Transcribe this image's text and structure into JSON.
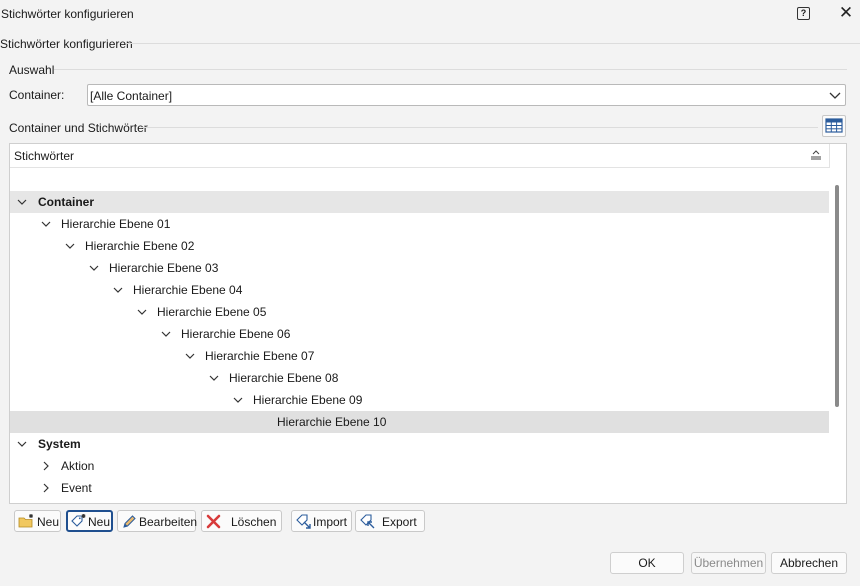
{
  "window": {
    "title": "Stichwörter konfigurieren"
  },
  "group_title": "Stichwörter konfigurieren",
  "auswahl": {
    "label": "Auswahl",
    "container_label": "Container:",
    "container_value": "[Alle Container]"
  },
  "tree_section_label": "Container und Stichwörter",
  "tree": {
    "header": "Stichwörter",
    "container_group": "Container",
    "levels": [
      "Hierarchie Ebene 01",
      "Hierarchie Ebene 02",
      "Hierarchie Ebene 03",
      "Hierarchie Ebene 04",
      "Hierarchie Ebene 05",
      "Hierarchie Ebene 06",
      "Hierarchie Ebene 07",
      "Hierarchie Ebene 08",
      "Hierarchie Ebene 09",
      "Hierarchie Ebene 10"
    ],
    "system_group": "System",
    "system_items": [
      "Aktion",
      "Event"
    ]
  },
  "toolbar": {
    "new_container": "Neu",
    "new_keyword": "Neu",
    "edit": "Bearbeiten",
    "delete": "Löschen",
    "import": "Import",
    "export": "Export"
  },
  "dialog_buttons": {
    "ok": "OK",
    "apply": "Übernehmen",
    "cancel": "Abbrechen"
  },
  "colors": {
    "accent": "#1f4f8f",
    "selection": "#e0e0e0",
    "delete": "#d83b3b"
  }
}
